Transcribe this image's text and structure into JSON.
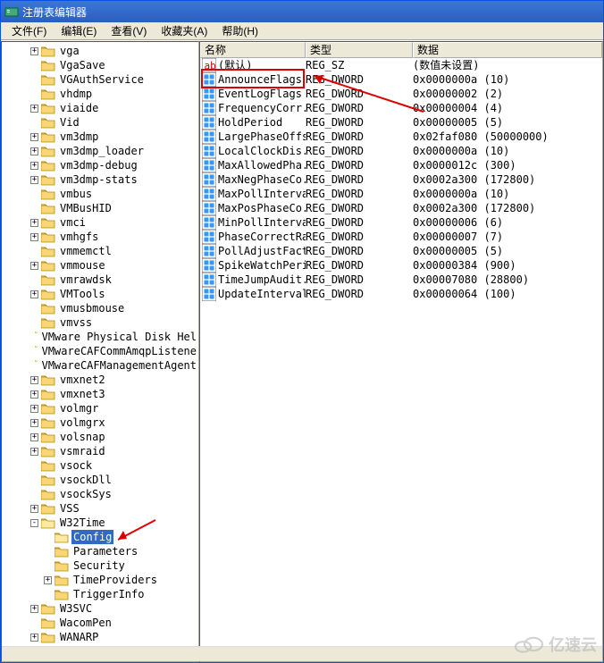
{
  "window": {
    "title": "注册表编辑器"
  },
  "menu": {
    "file": "文件(F)",
    "edit": "编辑(E)",
    "view": "查看(V)",
    "favorites": "收藏夹(A)",
    "help": "帮助(H)"
  },
  "listHeader": {
    "name": "名称",
    "type": "类型",
    "data": "数据"
  },
  "tree": {
    "items": [
      {
        "indent": 2,
        "toggle": "+",
        "label": "vga"
      },
      {
        "indent": 2,
        "toggle": "",
        "label": "VgaSave"
      },
      {
        "indent": 2,
        "toggle": "",
        "label": "VGAuthService"
      },
      {
        "indent": 2,
        "toggle": "",
        "label": "vhdmp"
      },
      {
        "indent": 2,
        "toggle": "+",
        "label": "viaide"
      },
      {
        "indent": 2,
        "toggle": "",
        "label": "Vid"
      },
      {
        "indent": 2,
        "toggle": "+",
        "label": "vm3dmp"
      },
      {
        "indent": 2,
        "toggle": "+",
        "label": "vm3dmp_loader"
      },
      {
        "indent": 2,
        "toggle": "+",
        "label": "vm3dmp-debug"
      },
      {
        "indent": 2,
        "toggle": "+",
        "label": "vm3dmp-stats"
      },
      {
        "indent": 2,
        "toggle": "",
        "label": "vmbus"
      },
      {
        "indent": 2,
        "toggle": "",
        "label": "VMBusHID"
      },
      {
        "indent": 2,
        "toggle": "+",
        "label": "vmci"
      },
      {
        "indent": 2,
        "toggle": "+",
        "label": "vmhgfs"
      },
      {
        "indent": 2,
        "toggle": "",
        "label": "vmmemctl"
      },
      {
        "indent": 2,
        "toggle": "+",
        "label": "vmmouse"
      },
      {
        "indent": 2,
        "toggle": "",
        "label": "vmrawdsk"
      },
      {
        "indent": 2,
        "toggle": "+",
        "label": "VMTools"
      },
      {
        "indent": 2,
        "toggle": "",
        "label": "vmusbmouse"
      },
      {
        "indent": 2,
        "toggle": "",
        "label": "vmvss"
      },
      {
        "indent": 2,
        "toggle": "",
        "label": "VMware Physical Disk Hel"
      },
      {
        "indent": 2,
        "toggle": "",
        "label": "VMwareCAFCommAmqpListene"
      },
      {
        "indent": 2,
        "toggle": "",
        "label": "VMwareCAFManagementAgent"
      },
      {
        "indent": 2,
        "toggle": "+",
        "label": "vmxnet2"
      },
      {
        "indent": 2,
        "toggle": "+",
        "label": "vmxnet3"
      },
      {
        "indent": 2,
        "toggle": "+",
        "label": "volmgr"
      },
      {
        "indent": 2,
        "toggle": "+",
        "label": "volmgrx"
      },
      {
        "indent": 2,
        "toggle": "+",
        "label": "volsnap"
      },
      {
        "indent": 2,
        "toggle": "+",
        "label": "vsmraid"
      },
      {
        "indent": 2,
        "toggle": "",
        "label": "vsock"
      },
      {
        "indent": 2,
        "toggle": "",
        "label": "vsockDll"
      },
      {
        "indent": 2,
        "toggle": "",
        "label": "vsockSys"
      },
      {
        "indent": 2,
        "toggle": "+",
        "label": "VSS"
      },
      {
        "indent": 2,
        "toggle": "-",
        "label": "W32Time"
      },
      {
        "indent": 3,
        "toggle": "",
        "label": "Config",
        "selected": true
      },
      {
        "indent": 3,
        "toggle": "",
        "label": "Parameters"
      },
      {
        "indent": 3,
        "toggle": "",
        "label": "Security"
      },
      {
        "indent": 3,
        "toggle": "+",
        "label": "TimeProviders"
      },
      {
        "indent": 3,
        "toggle": "",
        "label": "TriggerInfo"
      },
      {
        "indent": 2,
        "toggle": "+",
        "label": "W3SVC"
      },
      {
        "indent": 2,
        "toggle": "",
        "label": "WacomPen"
      },
      {
        "indent": 2,
        "toggle": "+",
        "label": "WANARP"
      }
    ]
  },
  "list": {
    "rows": [
      {
        "icon": "sz",
        "name": "(默认)",
        "type": "REG_SZ",
        "data": "(数值未设置)"
      },
      {
        "icon": "dw",
        "name": "AnnounceFlags",
        "type": "REG_DWORD",
        "data": "0x0000000a (10)",
        "highlight": true
      },
      {
        "icon": "dw",
        "name": "EventLogFlags",
        "type": "REG_DWORD",
        "data": "0x00000002 (2)"
      },
      {
        "icon": "dw",
        "name": "FrequencyCorr...",
        "type": "REG_DWORD",
        "data": "0x00000004 (4)"
      },
      {
        "icon": "dw",
        "name": "HoldPeriod",
        "type": "REG_DWORD",
        "data": "0x00000005 (5)"
      },
      {
        "icon": "dw",
        "name": "LargePhaseOffset",
        "type": "REG_DWORD",
        "data": "0x02faf080 (50000000)"
      },
      {
        "icon": "dw",
        "name": "LocalClockDis...",
        "type": "REG_DWORD",
        "data": "0x0000000a (10)"
      },
      {
        "icon": "dw",
        "name": "MaxAllowedPha...",
        "type": "REG_DWORD",
        "data": "0x0000012c (300)"
      },
      {
        "icon": "dw",
        "name": "MaxNegPhaseCo...",
        "type": "REG_DWORD",
        "data": "0x0002a300 (172800)"
      },
      {
        "icon": "dw",
        "name": "MaxPollInterval",
        "type": "REG_DWORD",
        "data": "0x0000000a (10)"
      },
      {
        "icon": "dw",
        "name": "MaxPosPhaseCo...",
        "type": "REG_DWORD",
        "data": "0x0002a300 (172800)"
      },
      {
        "icon": "dw",
        "name": "MinPollInterval",
        "type": "REG_DWORD",
        "data": "0x00000006 (6)"
      },
      {
        "icon": "dw",
        "name": "PhaseCorrectRate",
        "type": "REG_DWORD",
        "data": "0x00000007 (7)"
      },
      {
        "icon": "dw",
        "name": "PollAdjustFactor",
        "type": "REG_DWORD",
        "data": "0x00000005 (5)"
      },
      {
        "icon": "dw",
        "name": "SpikeWatchPeriod",
        "type": "REG_DWORD",
        "data": "0x00000384 (900)"
      },
      {
        "icon": "dw",
        "name": "TimeJumpAudit...",
        "type": "REG_DWORD",
        "data": "0x00007080 (28800)"
      },
      {
        "icon": "dw",
        "name": "UpdateInterval",
        "type": "REG_DWORD",
        "data": "0x00000064 (100)"
      }
    ]
  },
  "watermark": "亿速云"
}
